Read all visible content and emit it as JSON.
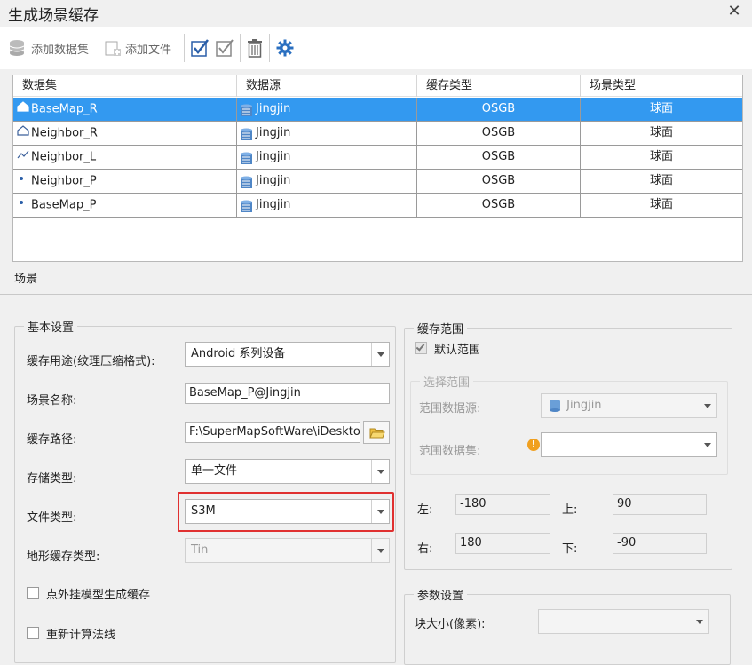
{
  "window": {
    "title": "生成场景缓存",
    "close_icon": "close-icon"
  },
  "toolbar": {
    "add_dataset": "添加数据集",
    "add_file": "添加文件"
  },
  "grid": {
    "columns": [
      "数据集",
      "数据源",
      "缓存类型",
      "场景类型"
    ],
    "rows": [
      {
        "dataset": "BaseMap_R",
        "icon": "region-icon",
        "datasource": "Jingjin",
        "cache_type": "OSGB",
        "scene_type": "球面",
        "selected": true
      },
      {
        "dataset": "Neighbor_R",
        "icon": "region-icon",
        "datasource": "Jingjin",
        "cache_type": "OSGB",
        "scene_type": "球面",
        "selected": false
      },
      {
        "dataset": "Neighbor_L",
        "icon": "line-icon",
        "datasource": "Jingjin",
        "cache_type": "OSGB",
        "scene_type": "球面",
        "selected": false
      },
      {
        "dataset": "Neighbor_P",
        "icon": "point-icon",
        "datasource": "Jingjin",
        "cache_type": "OSGB",
        "scene_type": "球面",
        "selected": false
      },
      {
        "dataset": "BaseMap_P",
        "icon": "point-icon",
        "datasource": "Jingjin",
        "cache_type": "OSGB",
        "scene_type": "球面",
        "selected": false
      }
    ]
  },
  "tab": {
    "label": "场景"
  },
  "basic": {
    "title": "基本设置",
    "usage_label": "缓存用途(纹理压缩格式):",
    "usage_value": "Android  系列设备",
    "scene_name_label": "场景名称:",
    "scene_name_value": "BaseMap_P@Jingjin",
    "cache_path_label": "缓存路径:",
    "cache_path_value": "F:\\SuperMapSoftWare\\iDesktop",
    "storage_label": "存储类型:",
    "storage_value": "单一文件",
    "file_type_label": "文件类型:",
    "file_type_value": "S3M",
    "terrain_label": "地形缓存类型:",
    "terrain_value": "Tin",
    "point_model_label": "点外挂模型生成缓存",
    "recalc_normal_label": "重新计算法线"
  },
  "range": {
    "title": "缓存范围",
    "default_label": "默认范围",
    "select_title": "选择范围",
    "ds_label": "范围数据源:",
    "ds_value": "Jingjin",
    "dataset_label": "范围数据集:",
    "left_label": "左:",
    "left_value": "-180",
    "top_label": "上:",
    "top_value": "90",
    "right_label": "右:",
    "right_value": "180",
    "bottom_label": "下:",
    "bottom_value": "-90"
  },
  "params": {
    "title": "参数设置",
    "tile_size_label": "块大小(像素):",
    "tile_size_value": ""
  },
  "colors": {
    "selection": "#3399f0",
    "highlight": "#e03030",
    "accent": "#2f6fbf"
  }
}
